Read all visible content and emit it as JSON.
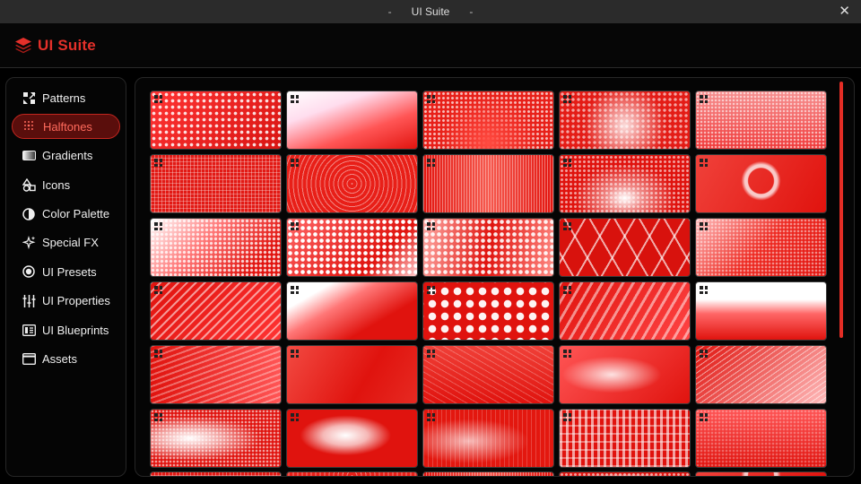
{
  "window": {
    "title": "UI Suite",
    "title_dash": "-",
    "close_glyph": "✕"
  },
  "app": {
    "logo_text": "UI Suite",
    "accent": "#e4302a"
  },
  "sidebar": {
    "items": [
      {
        "label": "Patterns",
        "icon": "patterns-icon",
        "active": false
      },
      {
        "label": "Halftones",
        "icon": "halftones-icon",
        "active": true
      },
      {
        "label": "Gradients",
        "icon": "gradients-icon",
        "active": false
      },
      {
        "label": "Icons",
        "icon": "shapes-icon",
        "active": false
      },
      {
        "label": "Color Palette",
        "icon": "contrast-icon",
        "active": false
      },
      {
        "label": "Special FX",
        "icon": "sparkle-icon",
        "active": false
      },
      {
        "label": "UI Presets",
        "icon": "radio-target-icon",
        "active": false
      },
      {
        "label": "UI Properties",
        "icon": "sliders-icon",
        "active": false
      },
      {
        "label": "UI Blueprints",
        "icon": "blueprint-icon",
        "active": false
      },
      {
        "label": "Assets",
        "icon": "window-icon",
        "active": false
      }
    ]
  },
  "grid": {
    "columns": 5,
    "visible_rows": 6,
    "tile_count": 30,
    "partial_row_count": 5
  }
}
